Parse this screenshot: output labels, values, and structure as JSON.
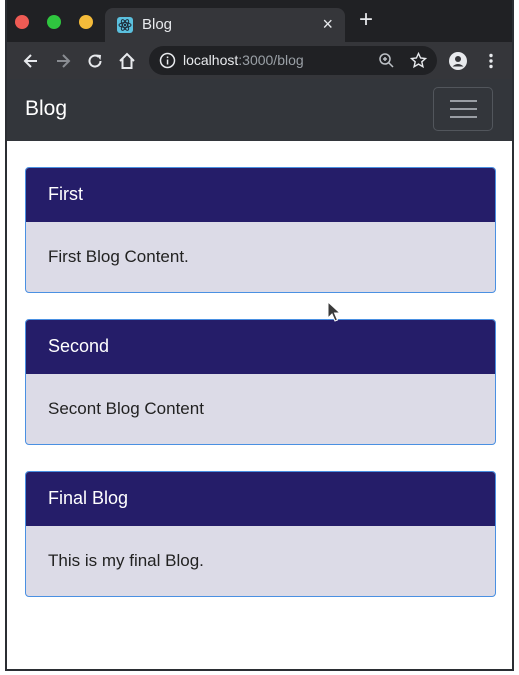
{
  "browser": {
    "tab": {
      "title": "Blog"
    },
    "url": {
      "host": "localhost",
      "rest": ":3000/blog"
    }
  },
  "navbar": {
    "brand": "Blog"
  },
  "posts": [
    {
      "title": "First",
      "content": "First Blog Content."
    },
    {
      "title": "Second",
      "content": "Secont Blog Content"
    },
    {
      "title": "Final Blog",
      "content": "This is my final Blog."
    }
  ],
  "colors": {
    "card_header": "#251d69",
    "card_body": "#dcdbe7",
    "card_border": "#4a90e2",
    "navbar": "#33363b"
  }
}
